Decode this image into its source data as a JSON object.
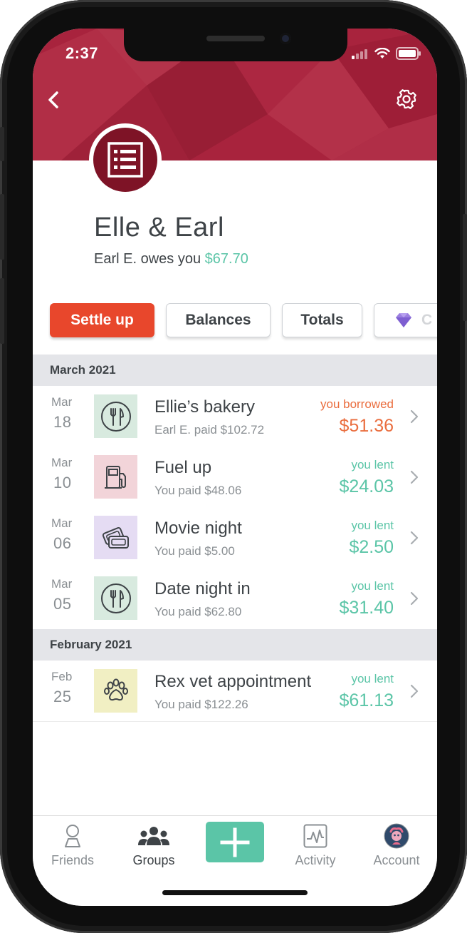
{
  "status_bar": {
    "time": "2:37"
  },
  "header": {
    "back_icon": "chevron-left-icon",
    "settings_icon": "gear-icon",
    "accent": "#a8233d"
  },
  "group": {
    "name": "Elle & Earl",
    "owes_prefix": "Earl E. owes you",
    "owes_amount": "$67.70",
    "avatar_icon": "receipt-list-icon"
  },
  "actions": {
    "settle_up": "Settle up",
    "balances": "Balances",
    "totals": "Totals",
    "partial_label": "C",
    "partial_icon": "gem-icon"
  },
  "sections": [
    {
      "label": "March 2021",
      "expenses": [
        {
          "month": "Mar",
          "day": "18",
          "title": "Ellie’s bakery",
          "subtitle": "Earl E. paid $102.72",
          "label": "you borrowed",
          "amount": "$51.36",
          "status": "borrowed",
          "category_icon": "fork-knife-icon",
          "category_color": "#d8eadf"
        },
        {
          "month": "Mar",
          "day": "10",
          "title": "Fuel up",
          "subtitle": "You paid $48.06",
          "label": "you lent",
          "amount": "$24.03",
          "status": "lent",
          "category_icon": "gas-pump-icon",
          "category_color": "#f2d4d9"
        },
        {
          "month": "Mar",
          "day": "06",
          "title": "Movie night",
          "subtitle": "You paid $5.00",
          "label": "you lent",
          "amount": "$2.50",
          "status": "lent",
          "category_icon": "tickets-icon",
          "category_color": "#e5dcf3"
        },
        {
          "month": "Mar",
          "day": "05",
          "title": "Date night in",
          "subtitle": "You paid $62.80",
          "label": "you lent",
          "amount": "$31.40",
          "status": "lent",
          "category_icon": "fork-knife-icon",
          "category_color": "#d8eadf"
        }
      ]
    },
    {
      "label": "February 2021",
      "expenses": [
        {
          "month": "Feb",
          "day": "25",
          "title": "Rex vet appointment",
          "subtitle": "You paid $122.26",
          "label": "you lent",
          "amount": "$61.13",
          "status": "lent",
          "category_icon": "paw-icon",
          "category_color": "#f1efc3"
        }
      ]
    }
  ],
  "tabbar": {
    "friends": "Friends",
    "groups": "Groups",
    "activity": "Activity",
    "account": "Account",
    "add_icon": "plus-icon"
  },
  "colors": {
    "lent": "#5bc5a7",
    "borrowed": "#ea6e3f",
    "settle": "#e8472c"
  }
}
